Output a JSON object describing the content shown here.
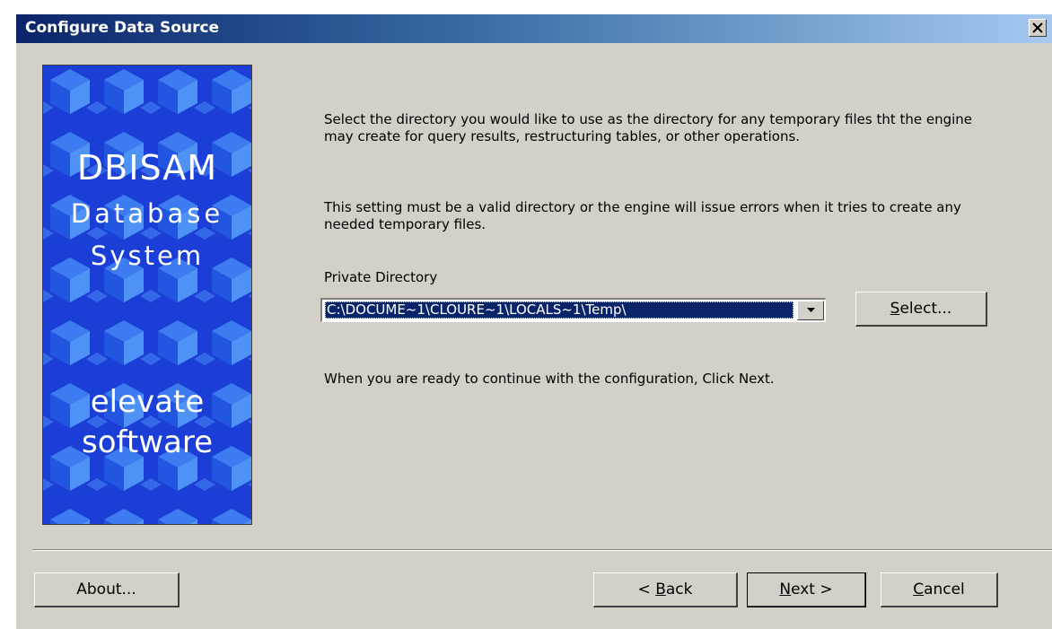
{
  "window": {
    "title": "Configure Data Source"
  },
  "banner": {
    "line1": "DBISAM",
    "line2": "Database",
    "line3": "System",
    "line4": "elevate",
    "line5": "software"
  },
  "content": {
    "paragraph1": "Select the directory you would like to use as the directory for any temporary files tht the engine may create for query results, restructuring tables, or other operations.",
    "paragraph2": "This setting must be a valid directory or the engine will issue errors when it tries to create any needed temporary files.",
    "private_dir_label": "Private Directory",
    "private_dir_value": "C:\\DOCUME~1\\CLOURE~1\\LOCALS~1\\Temp\\",
    "select_button": {
      "prefix": "",
      "accel": "S",
      "rest": "elect..."
    },
    "paragraph3": "When you are ready to continue with the configuration, Click Next."
  },
  "buttons": {
    "about": "About...",
    "back": {
      "prefix": "< ",
      "accel": "B",
      "rest": "ack"
    },
    "next": {
      "prefix": "",
      "accel": "N",
      "rest": "ext >"
    },
    "cancel": {
      "prefix": "",
      "accel": "C",
      "rest": "ancel"
    }
  },
  "icons": {
    "close": "close-icon",
    "dropdown": "chevron-down-icon"
  },
  "colors": {
    "titlebar_start": "#0a246a",
    "titlebar_end": "#a6caf0",
    "dialog_bg": "#d4d0c8",
    "banner_bg": "#1b3fd6",
    "selection": "#0a246a"
  }
}
